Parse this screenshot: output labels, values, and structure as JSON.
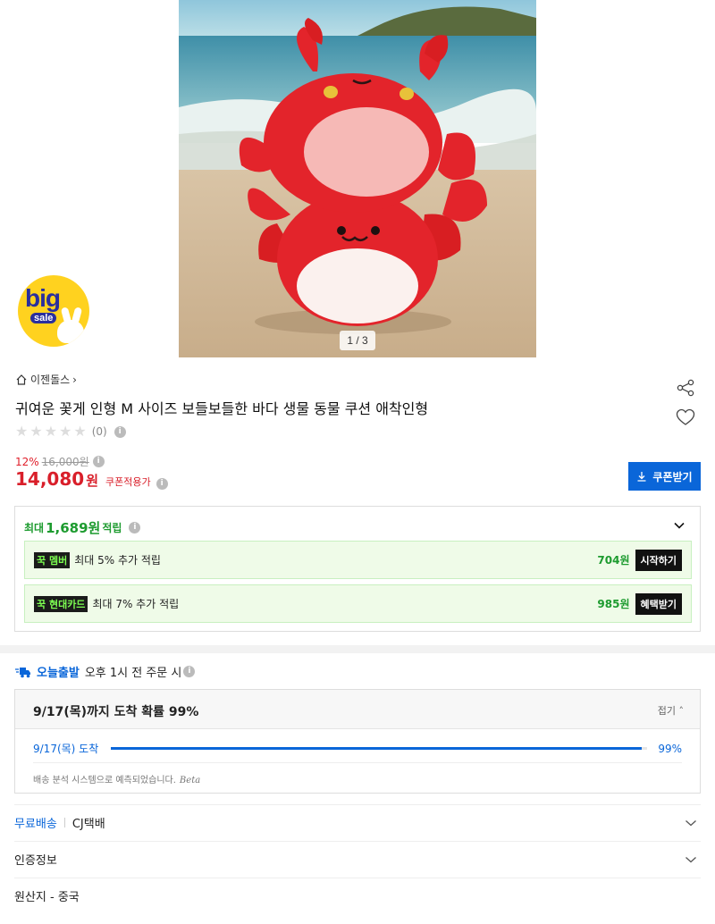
{
  "gallery": {
    "counter": "1 / 3"
  },
  "badge": {
    "big": "big",
    "sale": "sale"
  },
  "shop": {
    "name": "이젠돌스",
    "chevron": "›"
  },
  "product": {
    "title": "귀여운 꽃게 인형 M 사이즈 보들보들한 바다 생물 동물 쿠션 애착인형"
  },
  "rating": {
    "stars": 0,
    "max": 5,
    "count": "(0)"
  },
  "price": {
    "discount": "12%",
    "original": "16,000원",
    "final": "14,080",
    "unit": "원",
    "coupon_note": "쿠폰적용가"
  },
  "coupon_button": "쿠폰받기",
  "reward": {
    "prefix": "최대",
    "amount": "1,689원",
    "suffix": "적립",
    "benefits": [
      {
        "tag": "꾹 멤버",
        "text": "최대 5% 추가 적립",
        "points": "704원",
        "action": "시작하기"
      },
      {
        "tag": "꾹 현대카드",
        "text": "최대 7% 추가 적립",
        "points": "985원",
        "action": "혜택받기"
      }
    ]
  },
  "delivery": {
    "today_label": "오늘출발",
    "today_text": "오후 1시 전 주문 시",
    "headline": "9/17(목)까지 도착 확률 99%",
    "fold": "접기",
    "arrival": "9/17(목) 도착",
    "probability": 0.99,
    "probability_label": "99%",
    "note": "배송 분석 시스템으로 예측되었습니다.",
    "beta": "Beta"
  },
  "shipping": {
    "free": "무료배송",
    "carrier": "CJ택배"
  },
  "certification": "인증정보",
  "origin": "원산지 - 중국",
  "colors": {
    "accent": "#0a66d9",
    "price": "#d91f2a",
    "reward": "#1d9b2f"
  }
}
